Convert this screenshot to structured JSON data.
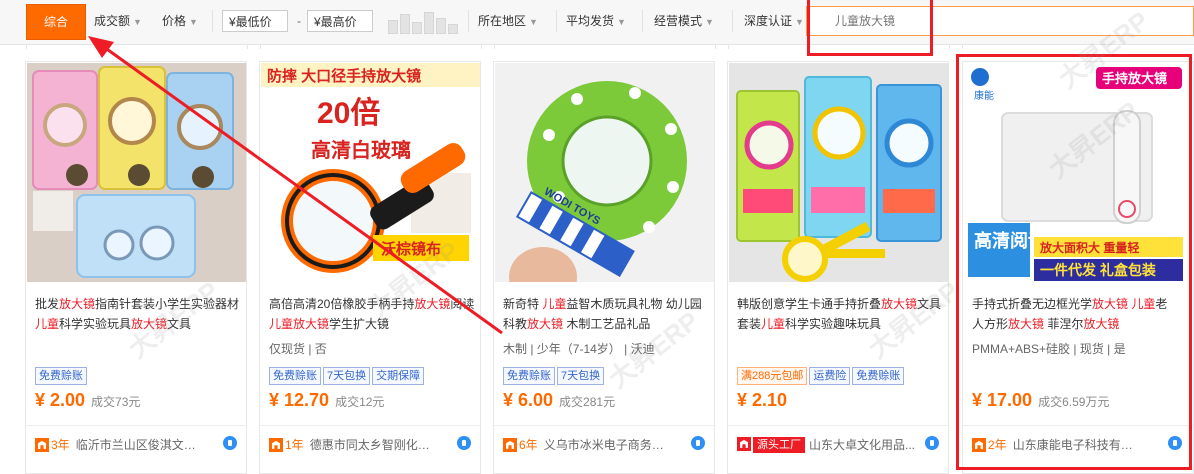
{
  "sort_bar": {
    "items": [
      {
        "label": "综合",
        "active": true
      },
      {
        "label": "成交额",
        "has_arrow": true
      },
      {
        "label": "价格",
        "has_arrow": true
      }
    ],
    "price_min_placeholder": "¥最低价",
    "price_dash": "-",
    "price_max_placeholder": "¥最高价",
    "filters": [
      {
        "label": "所在地区"
      },
      {
        "label": "平均发货"
      },
      {
        "label": "经营模式"
      },
      {
        "label": "深度认证"
      }
    ],
    "search_placeholder": "儿童放大镜"
  },
  "products": [
    {
      "title_parts": [
        "批发",
        "放大镜",
        "指南针套装小学生实验器材",
        "儿童",
        "科学实验玩具",
        "放大镜",
        "文具"
      ],
      "attrs": "",
      "tags": [
        "免费赊账"
      ],
      "tag_styles": [
        "blue"
      ],
      "price": "¥ 2.00",
      "sold": "成交73元",
      "seller_years": "3年",
      "seller_name": "临沂市兰山区俊淇文具厂",
      "source_badge": "",
      "seller_icon": "shop-badge-icon"
    },
    {
      "title_parts": [
        "高倍高清20倍橡胶手柄手持",
        "放大镜",
        "阅读",
        "儿童放大镜",
        "学生扩大镜"
      ],
      "attrs": "仅现货 | 否",
      "tags": [
        "免费赊账",
        "7天包换",
        "交期保障"
      ],
      "tag_styles": [
        "blue",
        "blue",
        "blue"
      ],
      "price": "¥ 12.70",
      "sold": "成交12元",
      "seller_years": "1年",
      "seller_name": "德惠市同太乡智刚化妆...",
      "source_badge": "",
      "seller_icon": "shop-badge-icon",
      "image_text": {
        "banner": "防摔 大口径手持放大镜",
        "zoom": "20倍",
        "glass": "高清白玻璃",
        "label": "沃棕镜布"
      }
    },
    {
      "title_parts": [
        "新奇特 ",
        "儿童",
        "益智木质玩具礼物 幼儿园科教",
        "放大镜",
        " 木制工艺品礼品"
      ],
      "attrs": "木制 | 少年（7-14岁） | 沃迪",
      "tags": [
        "免费赊账",
        "7天包换"
      ],
      "tag_styles": [
        "blue",
        "blue"
      ],
      "price": "¥ 6.00",
      "sold": "成交281元",
      "seller_years": "6年",
      "seller_name": "义乌市冰米电子商务商行",
      "source_badge": "",
      "seller_icon": "shop-badge-icon",
      "image_text": {
        "brand": "WODI TOYS"
      }
    },
    {
      "title_parts": [
        "韩版创意学生卡通手持折叠",
        "放大镜",
        "文具套装",
        "儿童",
        "科学实验趣味玩具"
      ],
      "attrs": "",
      "tags": [
        "满288元包邮",
        "运费险",
        "免费赊账"
      ],
      "tag_styles": [
        "orange",
        "blue",
        "blue"
      ],
      "price": "¥ 2.10",
      "sold": "",
      "seller_years": "",
      "seller_name": "山东大卓文化用品...",
      "source_badge": "源头工厂",
      "seller_icon": "factory-badge-icon"
    },
    {
      "title_parts": [
        "手持式折叠无边框光学",
        "放大镜",
        " ",
        "儿童",
        "老人方形",
        "放大镜",
        " 菲涅尔",
        "放大镜"
      ],
      "attrs": "PMMA+ABS+硅胶 | 现货 | 是",
      "tags": [],
      "tag_styles": [],
      "price": "¥ 17.00",
      "sold": "成交6.59万元",
      "seller_years": "2年",
      "seller_name": "山东康能电子科技有限...",
      "source_badge": "",
      "seller_icon": "shop-badge-icon",
      "image_text": {
        "brand": "康能",
        "badge": "手持放大镜",
        "left": "高清阅读",
        "top": "放大面积大 重量轻",
        "bottom": "一件代发 礼盒包装"
      }
    }
  ],
  "watermark": "大昇ERP",
  "colors": {
    "accent": "#ff6a00",
    "highlight": "#ee1c25",
    "link": "#3366cc"
  }
}
